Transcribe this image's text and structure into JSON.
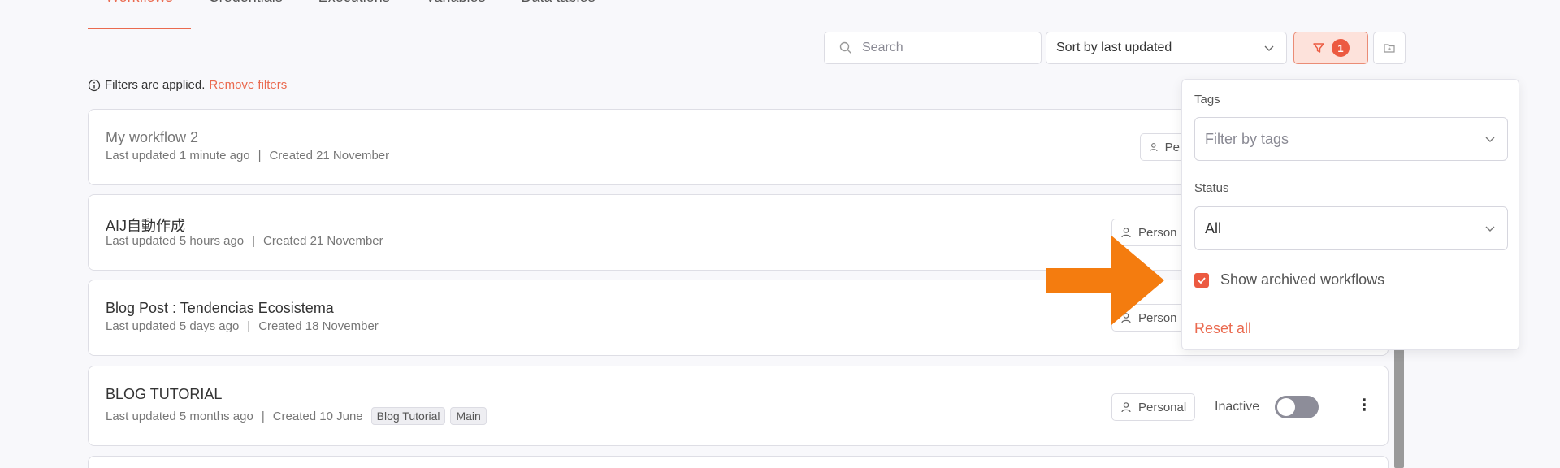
{
  "tabs": [
    {
      "label": "Workflows",
      "active": true
    },
    {
      "label": "Credentials"
    },
    {
      "label": "Executions"
    },
    {
      "label": "Variables"
    },
    {
      "label": "Data tables"
    }
  ],
  "toolbar": {
    "search_placeholder": "Search",
    "sort_label": "Sort by last updated",
    "filter_count": "1"
  },
  "filter_note": {
    "text": "Filters are applied.",
    "remove_label": "Remove filters"
  },
  "workflows": [
    {
      "name": "My workflow 2",
      "updated": "Last updated 1 minute ago",
      "created": "Created 21 November",
      "owner": "Pe"
    },
    {
      "name": "AIJ自動作成",
      "updated": "Last updated 5 hours ago",
      "created": "Created 21 November",
      "owner": "Person"
    },
    {
      "name": "Blog Post : Tendencias Ecosistema",
      "updated": "Last updated 5 days ago",
      "created": "Created 18 November",
      "owner": "Person"
    },
    {
      "name": "BLOG TUTORIAL",
      "updated": "Last updated 5 months ago",
      "created": "Created 10 June",
      "tags": [
        "Blog Tutorial",
        "Main"
      ],
      "owner": "Personal",
      "status": "Inactive"
    }
  ],
  "filter_panel": {
    "tags_label": "Tags",
    "tags_placeholder": "Filter by tags",
    "status_label": "Status",
    "status_value": "All",
    "archived_label": "Show archived workflows",
    "archived_checked": true,
    "reset_label": "Reset all"
  },
  "colors": {
    "accent": "#ea6a4f",
    "arrow": "#f47c0f"
  }
}
